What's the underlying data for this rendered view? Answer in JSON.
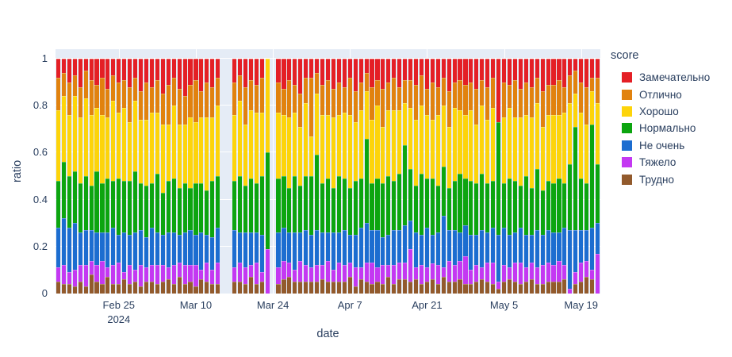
{
  "figure": {
    "background": "#ffffff",
    "plot_background": "#e5ecf6",
    "grid_color": "#ffffff",
    "text_color": "#2a3f5f"
  },
  "chart_data": {
    "type": "bar",
    "stacked": true,
    "normalized": true,
    "title": "",
    "xlabel": "date",
    "ylabel": "ratio",
    "ylim": [
      0,
      1
    ],
    "legend_title": "score",
    "legend_position": "right",
    "grid": true,
    "year": "2024",
    "x_start": "Feb 14",
    "x_end": "May 22",
    "missing_dates": [
      "Mar 15",
      "Mar 16",
      "Mar 24"
    ],
    "yticks": [
      {
        "label": "0",
        "value": 0
      },
      {
        "label": "0.2",
        "value": 0.2
      },
      {
        "label": "0.4",
        "value": 0.4
      },
      {
        "label": "0.6",
        "value": 0.6
      },
      {
        "label": "0.8",
        "value": 0.8
      },
      {
        "label": "1",
        "value": 1
      }
    ],
    "xticks": [
      {
        "label": "Feb 25",
        "sub": "2024",
        "date": "Feb 25"
      },
      {
        "label": "Mar 10",
        "sub": "",
        "date": "Mar 10"
      },
      {
        "label": "Mar 24",
        "sub": "",
        "date": "Mar 24"
      },
      {
        "label": "Apr 7",
        "sub": "",
        "date": "Apr 7"
      },
      {
        "label": "Apr 21",
        "sub": "",
        "date": "Apr 21"
      },
      {
        "label": "May 5",
        "sub": "",
        "date": "May 5"
      },
      {
        "label": "May 19",
        "sub": "",
        "date": "May 19"
      }
    ],
    "series_note": "series listed top-to-bottom in stack; bar values are percents in the same order, each bar sums to 100",
    "series": [
      {
        "name": "Замечательно",
        "color": "#e41f25"
      },
      {
        "name": "Отлично",
        "color": "#e1820e"
      },
      {
        "name": "Хорошо",
        "color": "#fdd40a"
      },
      {
        "name": "Нормально",
        "color": "#0ca50f"
      },
      {
        "name": "Не очень",
        "color": "#1c6dd0"
      },
      {
        "name": "Тяжело",
        "color": "#c438f2"
      },
      {
        "name": "Трудно",
        "color": "#925a2c"
      }
    ],
    "bars": [
      {
        "d": "Feb 14",
        "v": [
          8,
          14,
          30,
          20,
          17,
          6,
          5
        ]
      },
      {
        "d": "Feb 15",
        "v": [
          6,
          10,
          28,
          24,
          20,
          8,
          4
        ]
      },
      {
        "d": "Feb 16",
        "v": [
          10,
          14,
          26,
          22,
          19,
          5,
          4
        ]
      },
      {
        "d": "Feb 17",
        "v": [
          7,
          9,
          32,
          22,
          20,
          7,
          3
        ]
      },
      {
        "d": "Feb 18",
        "v": [
          12,
          13,
          28,
          21,
          14,
          7,
          5
        ]
      },
      {
        "d": "Feb 19",
        "v": [
          5,
          12,
          33,
          23,
          15,
          9,
          3
        ]
      },
      {
        "d": "Feb 20",
        "v": [
          9,
          15,
          30,
          19,
          13,
          6,
          8
        ]
      },
      {
        "d": "Feb 21",
        "v": [
          11,
          10,
          27,
          26,
          14,
          7,
          5
        ]
      },
      {
        "d": "Feb 22",
        "v": [
          8,
          16,
          29,
          21,
          12,
          10,
          4
        ]
      },
      {
        "d": "Feb 23",
        "v": [
          13,
          12,
          26,
          23,
          15,
          4,
          7
        ]
      },
      {
        "d": "Feb 24",
        "v": [
          7,
          11,
          34,
          20,
          16,
          8,
          4
        ]
      },
      {
        "d": "Feb 25",
        "v": [
          10,
          13,
          28,
          24,
          12,
          9,
          4
        ]
      },
      {
        "d": "Feb 26",
        "v": [
          9,
          12,
          31,
          22,
          17,
          3,
          6
        ]
      },
      {
        "d": "Feb 27",
        "v": [
          12,
          15,
          25,
          23,
          13,
          8,
          4
        ]
      },
      {
        "d": "Feb 28",
        "v": [
          8,
          10,
          30,
          26,
          16,
          5,
          5
        ]
      },
      {
        "d": "Feb 29",
        "v": [
          14,
          12,
          27,
          20,
          15,
          9,
          3
        ]
      },
      {
        "d": "Mar 1",
        "v": [
          10,
          16,
          28,
          22,
          13,
          6,
          5
        ]
      },
      {
        "d": "Mar 2",
        "v": [
          12,
          11,
          30,
          19,
          16,
          7,
          5
        ]
      },
      {
        "d": "Mar 3",
        "v": [
          9,
          14,
          26,
          25,
          14,
          8,
          4
        ]
      },
      {
        "d": "Mar 4",
        "v": [
          15,
          13,
          29,
          18,
          13,
          7,
          5
        ]
      },
      {
        "d": "Mar 5",
        "v": [
          11,
          17,
          24,
          22,
          15,
          5,
          6
        ]
      },
      {
        "d": "Mar 6",
        "v": [
          8,
          12,
          31,
          23,
          14,
          8,
          4
        ]
      },
      {
        "d": "Mar 7",
        "v": [
          13,
          15,
          27,
          20,
          12,
          6,
          7
        ]
      },
      {
        "d": "Mar 8",
        "v": [
          16,
          12,
          25,
          21,
          14,
          8,
          4
        ]
      },
      {
        "d": "Mar 9",
        "v": [
          11,
          14,
          30,
          18,
          15,
          7,
          5
        ]
      },
      {
        "d": "Mar 10",
        "v": [
          9,
          18,
          26,
          22,
          13,
          9,
          3
        ]
      },
      {
        "d": "Mar 11",
        "v": [
          14,
          11,
          28,
          21,
          16,
          4,
          6
        ]
      },
      {
        "d": "Mar 12",
        "v": [
          10,
          15,
          31,
          19,
          12,
          8,
          5
        ]
      },
      {
        "d": "Mar 13",
        "v": [
          12,
          13,
          27,
          24,
          14,
          6,
          4
        ]
      },
      {
        "d": "Mar 14",
        "v": [
          8,
          12,
          30,
          22,
          15,
          9,
          4
        ]
      },
      {
        "d": "Mar 17",
        "v": [
          10,
          14,
          28,
          21,
          16,
          6,
          5
        ]
      },
      {
        "d": "Mar 18",
        "v": [
          7,
          11,
          32,
          24,
          13,
          8,
          5
        ]
      },
      {
        "d": "Mar 19",
        "v": [
          12,
          16,
          26,
          20,
          15,
          7,
          4
        ]
      },
      {
        "d": "Mar 20",
        "v": [
          9,
          13,
          29,
          23,
          14,
          5,
          7
        ]
      },
      {
        "d": "Mar 21",
        "v": [
          11,
          12,
          30,
          21,
          13,
          9,
          4
        ]
      },
      {
        "d": "Mar 22",
        "v": [
          8,
          15,
          27,
          25,
          16,
          4,
          5
        ]
      },
      {
        "d": "Mar 23",
        "v": [
          0,
          0,
          40,
          41,
          0,
          19,
          0
        ]
      },
      {
        "d": "Mar 25",
        "v": [
          10,
          13,
          28,
          23,
          15,
          7,
          4
        ]
      },
      {
        "d": "Mar 26",
        "v": [
          13,
          11,
          26,
          22,
          14,
          8,
          6
        ]
      },
      {
        "d": "Mar 27",
        "v": [
          9,
          16,
          30,
          19,
          13,
          6,
          7
        ]
      },
      {
        "d": "Mar 28",
        "v": [
          11,
          12,
          27,
          24,
          16,
          5,
          5
        ]
      },
      {
        "d": "Mar 29",
        "v": [
          15,
          14,
          25,
          20,
          12,
          9,
          5
        ]
      },
      {
        "d": "Mar 30",
        "v": [
          8,
          11,
          31,
          23,
          15,
          7,
          5
        ]
      },
      {
        "d": "Mar 31",
        "v": [
          8,
          25,
          17,
          25,
          14,
          6,
          5
        ]
      },
      {
        "d": "Apr 1",
        "v": [
          6,
          9,
          26,
          32,
          15,
          7,
          5
        ]
      },
      {
        "d": "Apr 2",
        "v": [
          11,
          13,
          29,
          21,
          14,
          6,
          6
        ]
      },
      {
        "d": "Apr 3",
        "v": [
          9,
          15,
          27,
          23,
          12,
          9,
          5
        ]
      },
      {
        "d": "Apr 4",
        "v": [
          13,
          12,
          30,
          19,
          16,
          5,
          5
        ]
      },
      {
        "d": "Apr 5",
        "v": [
          10,
          14,
          26,
          24,
          13,
          8,
          5
        ]
      },
      {
        "d": "Apr 6",
        "v": [
          12,
          11,
          28,
          22,
          15,
          7,
          5
        ]
      },
      {
        "d": "Apr 7",
        "v": [
          8,
          16,
          31,
          20,
          12,
          6,
          7
        ]
      },
      {
        "d": "Apr 8",
        "v": [
          14,
          13,
          25,
          23,
          14,
          8,
          3
        ]
      },
      {
        "d": "Apr 9",
        "v": [
          10,
          12,
          29,
          21,
          17,
          5,
          6
        ]
      },
      {
        "d": "Apr 10",
        "v": [
          6,
          8,
          20,
          36,
          17,
          8,
          5
        ]
      },
      {
        "d": "Apr 11",
        "v": [
          12,
          14,
          27,
          20,
          14,
          9,
          4
        ]
      },
      {
        "d": "Apr 12",
        "v": [
          9,
          11,
          31,
          22,
          16,
          6,
          5
        ]
      },
      {
        "d": "Apr 13",
        "v": [
          13,
          16,
          24,
          23,
          12,
          8,
          4
        ]
      },
      {
        "d": "Apr 14",
        "v": [
          10,
          12,
          28,
          25,
          13,
          5,
          7
        ]
      },
      {
        "d": "Apr 15",
        "v": [
          8,
          14,
          30,
          21,
          15,
          8,
          4
        ]
      },
      {
        "d": "Apr 16",
        "v": [
          12,
          10,
          27,
          24,
          14,
          7,
          6
        ]
      },
      {
        "d": "Apr 17",
        "v": [
          9,
          10,
          18,
          34,
          16,
          7,
          6
        ]
      },
      {
        "d": "Apr 18",
        "v": [
          9,
          12,
          26,
          22,
          12,
          14,
          5
        ]
      },
      {
        "d": "Apr 19",
        "v": [
          11,
          15,
          28,
          20,
          15,
          5,
          6
        ]
      },
      {
        "d": "Apr 20",
        "v": [
          7,
          13,
          29,
          26,
          13,
          8,
          4
        ]
      },
      {
        "d": "Apr 21",
        "v": [
          13,
          11,
          27,
          21,
          17,
          6,
          5
        ]
      },
      {
        "d": "Apr 22",
        "v": [
          10,
          16,
          25,
          24,
          12,
          7,
          6
        ]
      },
      {
        "d": "Apr 23",
        "v": [
          12,
          12,
          30,
          20,
          14,
          8,
          4
        ]
      },
      {
        "d": "Apr 24",
        "v": [
          8,
          12,
          26,
          21,
          22,
          4,
          7
        ]
      },
      {
        "d": "Apr 25",
        "v": [
          14,
          15,
          26,
          18,
          13,
          9,
          5
        ]
      },
      {
        "d": "Apr 26",
        "v": [
          10,
          11,
          31,
          21,
          15,
          7,
          5
        ]
      },
      {
        "d": "Apr 27",
        "v": [
          9,
          13,
          27,
          25,
          12,
          8,
          6
        ]
      },
      {
        "d": "Apr 28",
        "v": [
          11,
          13,
          27,
          20,
          13,
          12,
          4
        ]
      },
      {
        "d": "Apr 29",
        "v": [
          10,
          12,
          30,
          23,
          15,
          6,
          4
        ]
      },
      {
        "d": "Apr 30",
        "v": [
          13,
          15,
          25,
          22,
          13,
          7,
          5
        ]
      },
      {
        "d": "May 1",
        "v": [
          9,
          11,
          29,
          24,
          16,
          5,
          6
        ]
      },
      {
        "d": "May 2",
        "v": [
          12,
          14,
          27,
          21,
          13,
          8,
          5
        ]
      },
      {
        "d": "May 3",
        "v": [
          8,
          13,
          31,
          20,
          15,
          9,
          4
        ]
      },
      {
        "d": "May 4",
        "v": [
          27,
          0,
          0,
          48,
          20,
          3,
          2
        ]
      },
      {
        "d": "May 5",
        "v": [
          10,
          15,
          28,
          19,
          16,
          7,
          5
        ]
      },
      {
        "d": "May 6",
        "v": [
          11,
          10,
          30,
          24,
          14,
          5,
          6
        ]
      },
      {
        "d": "May 7",
        "v": [
          9,
          16,
          27,
          22,
          13,
          8,
          5
        ]
      },
      {
        "d": "May 8",
        "v": [
          13,
          12,
          29,
          18,
          15,
          9,
          4
        ]
      },
      {
        "d": "May 9",
        "v": [
          10,
          14,
          26,
          25,
          14,
          6,
          5
        ]
      },
      {
        "d": "May 10",
        "v": [
          12,
          13,
          30,
          20,
          12,
          7,
          6
        ]
      },
      {
        "d": "May 11",
        "v": [
          8,
          11,
          28,
          26,
          16,
          7,
          4
        ]
      },
      {
        "d": "May 12",
        "v": [
          14,
          15,
          27,
          19,
          13,
          8,
          4
        ]
      },
      {
        "d": "May 13",
        "v": [
          11,
          13,
          28,
          21,
          14,
          8,
          5
        ]
      },
      {
        "d": "May 14",
        "v": [
          11,
          13,
          29,
          21,
          14,
          7,
          5
        ]
      },
      {
        "d": "May 15",
        "v": [
          9,
          15,
          27,
          23,
          12,
          9,
          5
        ]
      },
      {
        "d": "May 16",
        "v": [
          12,
          11,
          30,
          19,
          16,
          6,
          6
        ]
      },
      {
        "d": "May 17",
        "v": [
          7,
          12,
          26,
          28,
          25,
          2,
          0
        ]
      },
      {
        "d": "May 18",
        "v": [
          5,
          10,
          14,
          44,
          18,
          5,
          4
        ]
      },
      {
        "d": "May 19",
        "v": [
          10,
          13,
          28,
          22,
          14,
          8,
          5
        ]
      },
      {
        "d": "May 20",
        "v": [
          12,
          16,
          25,
          20,
          13,
          7,
          7
        ]
      },
      {
        "d": "May 21",
        "v": [
          8,
          6,
          14,
          44,
          18,
          4,
          6
        ]
      },
      {
        "d": "May 22",
        "v": [
          8,
          11,
          26,
          25,
          13,
          17,
          0
        ]
      }
    ]
  }
}
